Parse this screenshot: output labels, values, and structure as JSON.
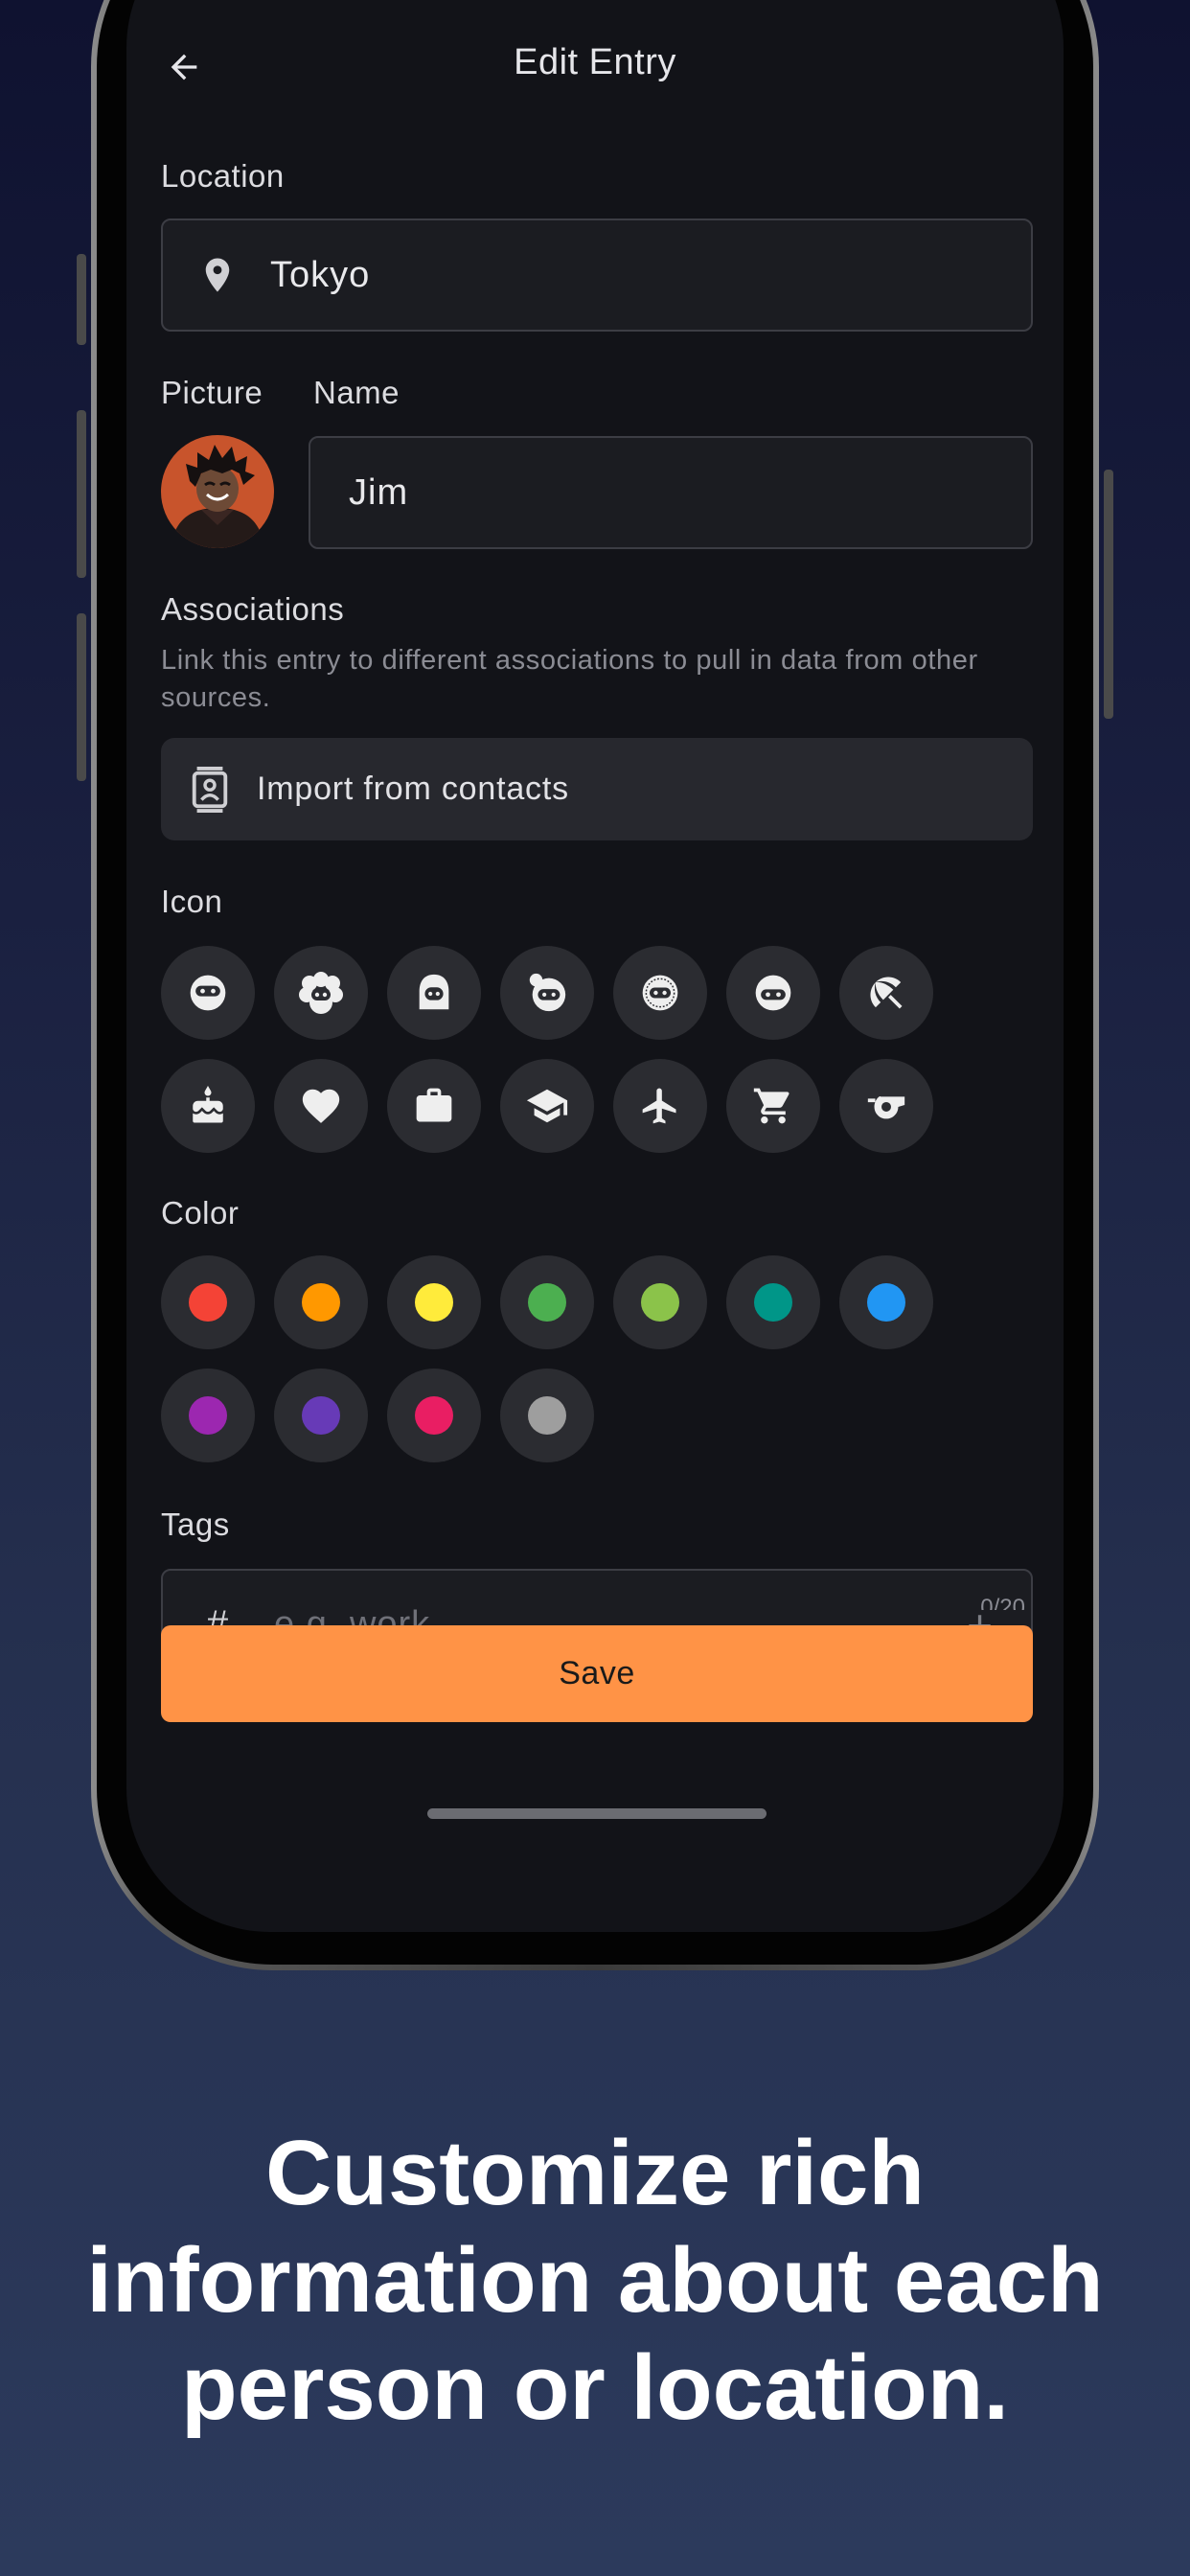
{
  "header": {
    "title": "Edit Entry"
  },
  "location": {
    "label": "Location",
    "value": "Tokyo"
  },
  "picture": {
    "label": "Picture"
  },
  "name": {
    "label": "Name",
    "value": "Jim"
  },
  "associations": {
    "label": "Associations",
    "description": "Link this entry to different associations to pull in data from other sources.",
    "import_label": "Import from contacts"
  },
  "icon_section": {
    "label": "Icon",
    "icons": [
      "face-icon",
      "face-curly-hair-icon",
      "face-long-hair-icon",
      "face-bun-hair-icon",
      "face-buzz-hair-icon",
      "face-smile-icon",
      "umbrella-beach-icon",
      "cake-icon",
      "heart-icon",
      "briefcase-icon",
      "graduation-cap-icon",
      "airplane-icon",
      "shopping-cart-icon",
      "whistle-icon"
    ]
  },
  "color_section": {
    "label": "Color",
    "colors": [
      "#f44336",
      "#ff9800",
      "#ffeb3b",
      "#4caf50",
      "#8bc34a",
      "#009688",
      "#2196f3",
      "#9c27b0",
      "#673ab7",
      "#e91e63",
      "#9e9e9e"
    ]
  },
  "tags": {
    "label": "Tags",
    "placeholder": "e.g. work",
    "counter": "0/20"
  },
  "save_label": "Save",
  "caption": {
    "line1": "Customize rich",
    "line2": "information about each",
    "line3": "person or location."
  }
}
